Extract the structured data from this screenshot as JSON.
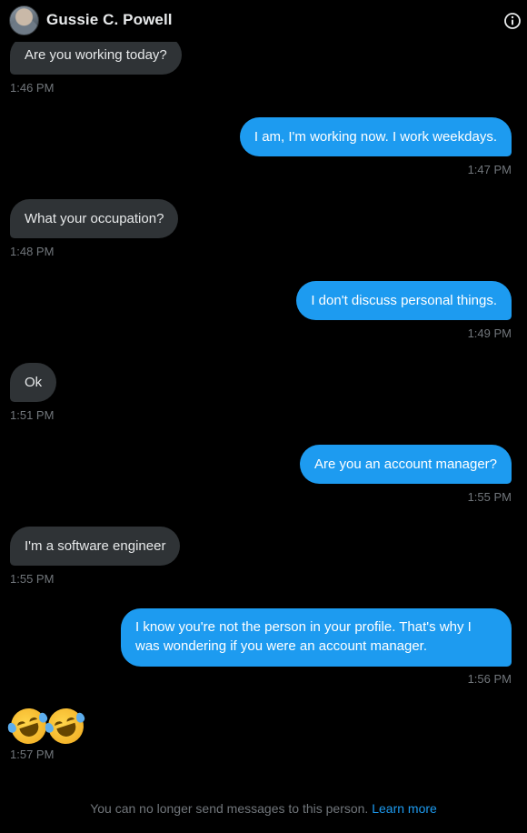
{
  "header": {
    "contact_name": "Gussie C. Powell"
  },
  "messages": [
    {
      "direction": "in",
      "text": "Are you working today?",
      "time": "1:46 PM"
    },
    {
      "direction": "out",
      "text": "I am, I'm working now. I work weekdays.",
      "time": "1:47 PM"
    },
    {
      "direction": "in",
      "text": "What your occupation?",
      "time": "1:48 PM"
    },
    {
      "direction": "out",
      "text": "I don't discuss personal things.",
      "time": "1:49 PM"
    },
    {
      "direction": "in",
      "text": "Ok",
      "time": "1:51 PM"
    },
    {
      "direction": "out",
      "text": "Are you an account manager?",
      "time": "1:55 PM"
    },
    {
      "direction": "in",
      "text": "I'm a software engineer",
      "time": "1:55 PM"
    },
    {
      "direction": "out",
      "text": "I know you're not the person in your profile. That's why I was wondering if you were an account manager.",
      "time": "1:56 PM"
    },
    {
      "direction": "in",
      "text": "🤣🤣",
      "time": "1:57 PM",
      "emoji_names": [
        "rolling-on-floor-laughing-emoji",
        "rolling-on-floor-laughing-emoji"
      ]
    }
  ],
  "footer": {
    "notice": "You can no longer send messages to this person.",
    "link_label": "Learn more"
  },
  "colors": {
    "background": "#000000",
    "incoming_bubble": "#2f3336",
    "outgoing_bubble": "#1d9bf0",
    "timestamp": "#71767b",
    "link": "#1d9bf0"
  }
}
